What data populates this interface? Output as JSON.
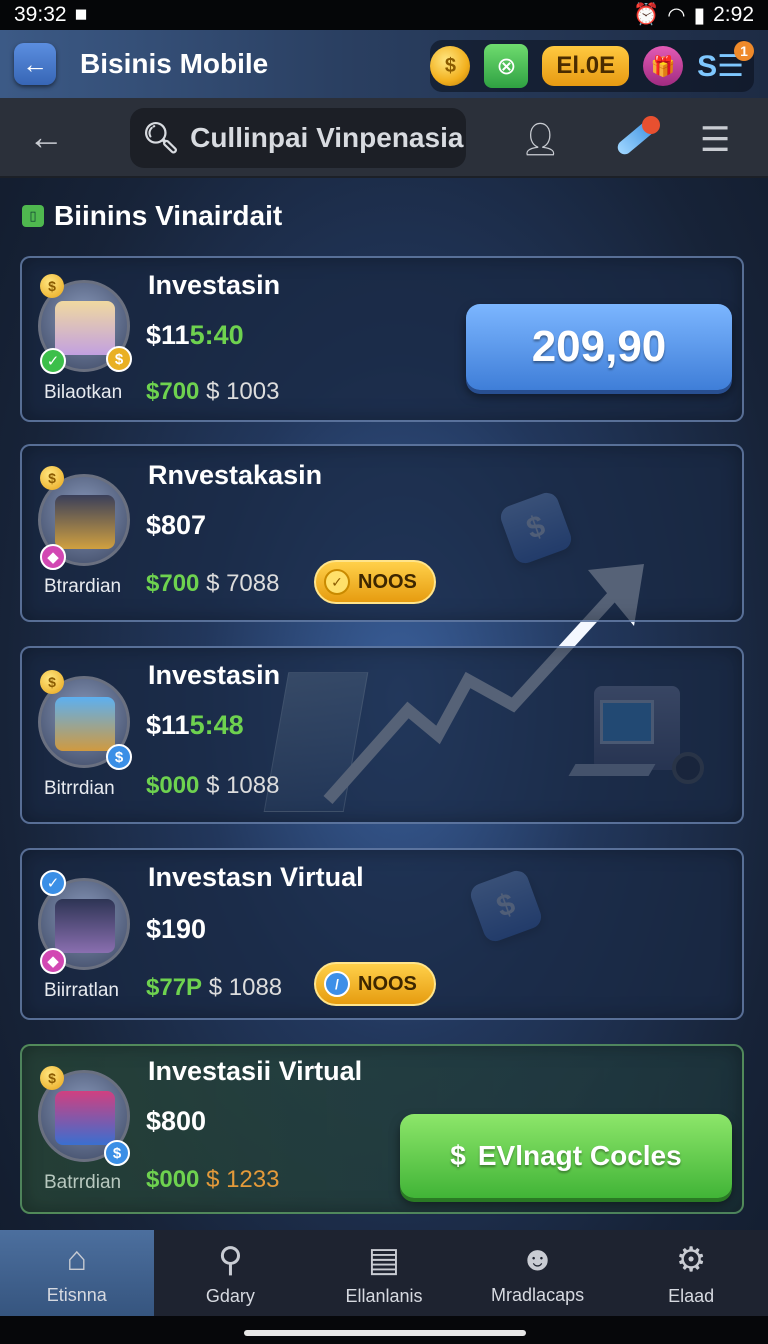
{
  "status_bar": {
    "time_left": "39:32",
    "time_right": "2:92"
  },
  "app_bar": {
    "back_icon": "arrow-left-icon",
    "title": "Bisinis Mobile",
    "currency_value": "El.0E",
    "menu_badge": "1",
    "menu_label": "S☰"
  },
  "search_row": {
    "back_icon": "arrow-left-icon",
    "search_text": "Cullinpai Vinpenasia"
  },
  "section": {
    "title": "Biinins Vinairdait"
  },
  "cards": [
    {
      "title": "Investasin",
      "price_white": "$11",
      "price_green": "5:40",
      "owner": "Bilaotkan",
      "income_green": "$700",
      "income_rest": "$ 1003",
      "action": "209,90"
    },
    {
      "title": "Rnvestakasin",
      "price_white": "$807",
      "price_green": "",
      "owner": "Btrardian",
      "income_green": "$700",
      "income_rest": "$ 7088",
      "pill": "NOOS"
    },
    {
      "title": "Investasin",
      "price_white": "$11",
      "price_green": "5:48",
      "owner": "Bitrrdian",
      "income_green": "$000",
      "income_rest": "$ 1088"
    },
    {
      "title": "Investasn Virtual",
      "price_white": "$190",
      "price_green": "",
      "owner": "Biirratlan",
      "income_green": "$77P",
      "income_rest": "$ 1088",
      "pill": "NOOS"
    },
    {
      "title": "Investasii Virtual",
      "price_white": "$800",
      "price_green": "",
      "owner": "Batrrdian",
      "income_green": "$000",
      "income_rest": "$ 1233",
      "action": "EVlnagt Cocles"
    }
  ],
  "bottom_nav": [
    {
      "label": "Etisnna",
      "icon": "home-icon"
    },
    {
      "label": "Gdary",
      "icon": "search-icon"
    },
    {
      "label": "Ellanlanis",
      "icon": "clipboard-icon"
    },
    {
      "label": "Mradlacaps",
      "icon": "people-icon"
    },
    {
      "label": "Elaad",
      "icon": "gear-icon"
    }
  ],
  "colors": {
    "accent_blue": "#4f8ee6",
    "accent_green": "#5cc84a",
    "gold": "#f2b01e",
    "income_green": "#6ed24f"
  }
}
